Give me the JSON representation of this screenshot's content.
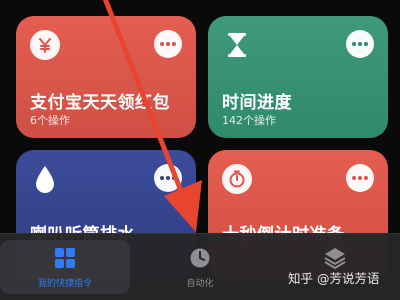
{
  "shortcuts": [
    {
      "title": "支付宝天天领红包",
      "subtitle": "6个操作",
      "icon": "yen-icon",
      "color": "#d9564c"
    },
    {
      "title": "时间进度",
      "subtitle": "142个操作",
      "icon": "hourglass-icon",
      "color": "#2f8a6b"
    },
    {
      "title": "喇叭听筒排水",
      "subtitle": "",
      "icon": "water-drop-icon",
      "color": "#33418a"
    },
    {
      "title": "十秒倒计时准备",
      "subtitle": "",
      "icon": "stopwatch-icon",
      "color": "#d9564c"
    }
  ],
  "tabbar": {
    "tabs": [
      {
        "label": "我的快捷指令",
        "icon": "grid-icon",
        "active": true
      },
      {
        "label": "自动化",
        "icon": "clock-icon",
        "active": false
      },
      {
        "label": "",
        "icon": "layers-icon",
        "active": false
      }
    ],
    "accent": "#2f7cf6"
  },
  "watermark": "知乎 @芳说芳语",
  "annotation": {
    "type": "arrow",
    "color": "#e8452f"
  }
}
